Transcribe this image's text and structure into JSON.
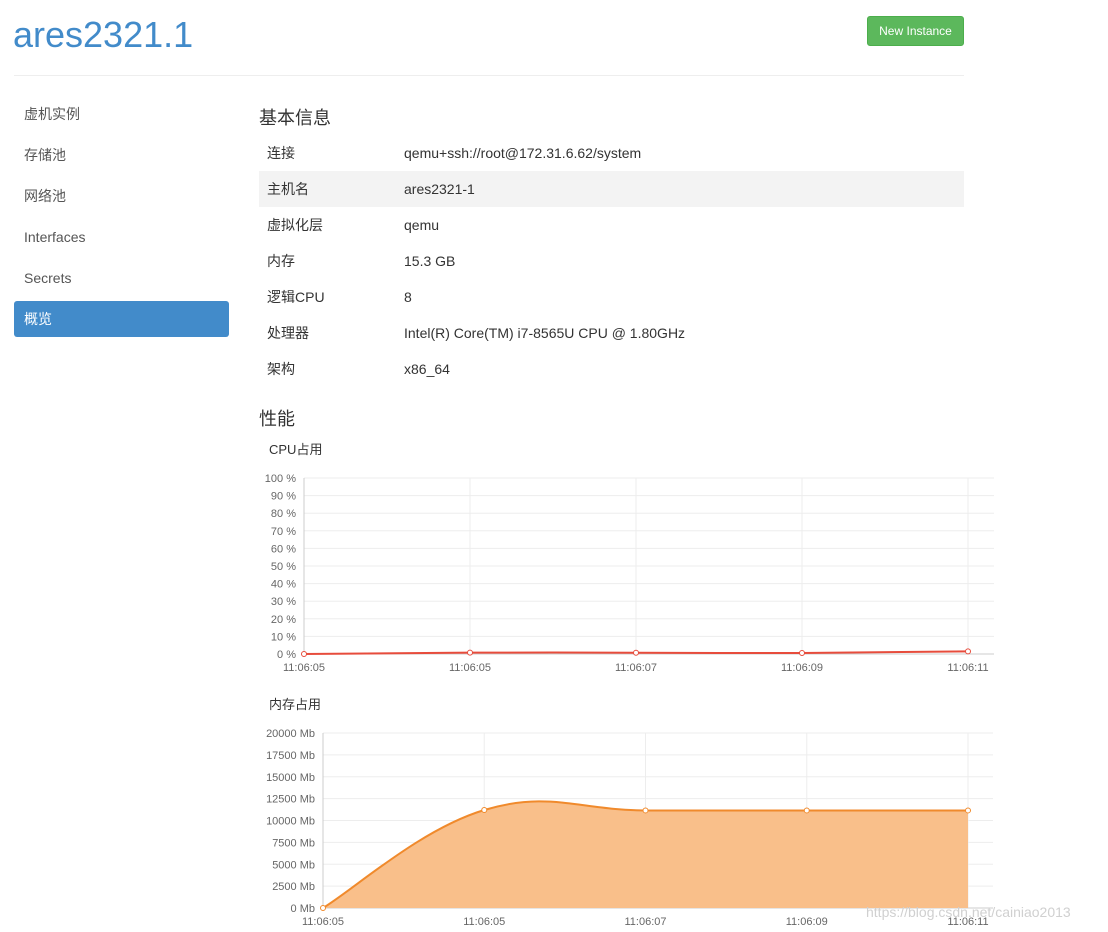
{
  "header": {
    "title": "ares2321.1",
    "new_instance_label": "New Instance"
  },
  "sidebar": {
    "items": [
      {
        "label": "虚机实例"
      },
      {
        "label": "存储池"
      },
      {
        "label": "网络池"
      },
      {
        "label": "Interfaces"
      },
      {
        "label": "Secrets"
      },
      {
        "label": "概览",
        "active": true
      }
    ]
  },
  "basic_info": {
    "title": "基本信息",
    "rows": [
      {
        "key": "连接",
        "value": "qemu+ssh://root@172.31.6.62/system"
      },
      {
        "key": "主机名",
        "value": "ares2321-1"
      },
      {
        "key": "虚拟化层",
        "value": "qemu"
      },
      {
        "key": "内存",
        "value": "15.3 GB"
      },
      {
        "key": "逻辑CPU",
        "value": "8"
      },
      {
        "key": "处理器",
        "value": "Intel(R) Core(TM) i7-8565U CPU @ 1.80GHz"
      },
      {
        "key": "架构",
        "value": "x86_64"
      }
    ]
  },
  "performance": {
    "title": "性能"
  },
  "chart_data": [
    {
      "type": "line",
      "title": "CPU占用",
      "categories": [
        "11:06:05",
        "11:06:05",
        "11:06:07",
        "11:06:09",
        "11:06:11"
      ],
      "series": [
        {
          "values": [
            0,
            0.8,
            0.7,
            0.6,
            1.5
          ],
          "color": "#e74c3c"
        }
      ],
      "ylim": [
        0,
        100
      ],
      "yticks": [
        "100 %",
        "90 %",
        "80 %",
        "70 %",
        "60 %",
        "50 %",
        "40 %",
        "30 %",
        "20 %",
        "10 %",
        "0 %"
      ],
      "grid": true
    },
    {
      "type": "area",
      "title": "内存占用",
      "categories": [
        "11:06:05",
        "11:06:05",
        "11:06:07",
        "11:06:09",
        "11:06:11"
      ],
      "series": [
        {
          "values": [
            0,
            11200,
            11150,
            11150,
            11150
          ],
          "color": "#f08a2c",
          "fill": "#f9bf8a"
        }
      ],
      "ylim": [
        0,
        20000
      ],
      "yticks": [
        "20000 Mb",
        "17500 Mb",
        "15000 Mb",
        "12500 Mb",
        "10000 Mb",
        "7500 Mb",
        "5000 Mb",
        "2500 Mb",
        "0 Mb"
      ],
      "grid": true
    }
  ],
  "watermark": "https://blog.csdn.net/cainiao2013"
}
